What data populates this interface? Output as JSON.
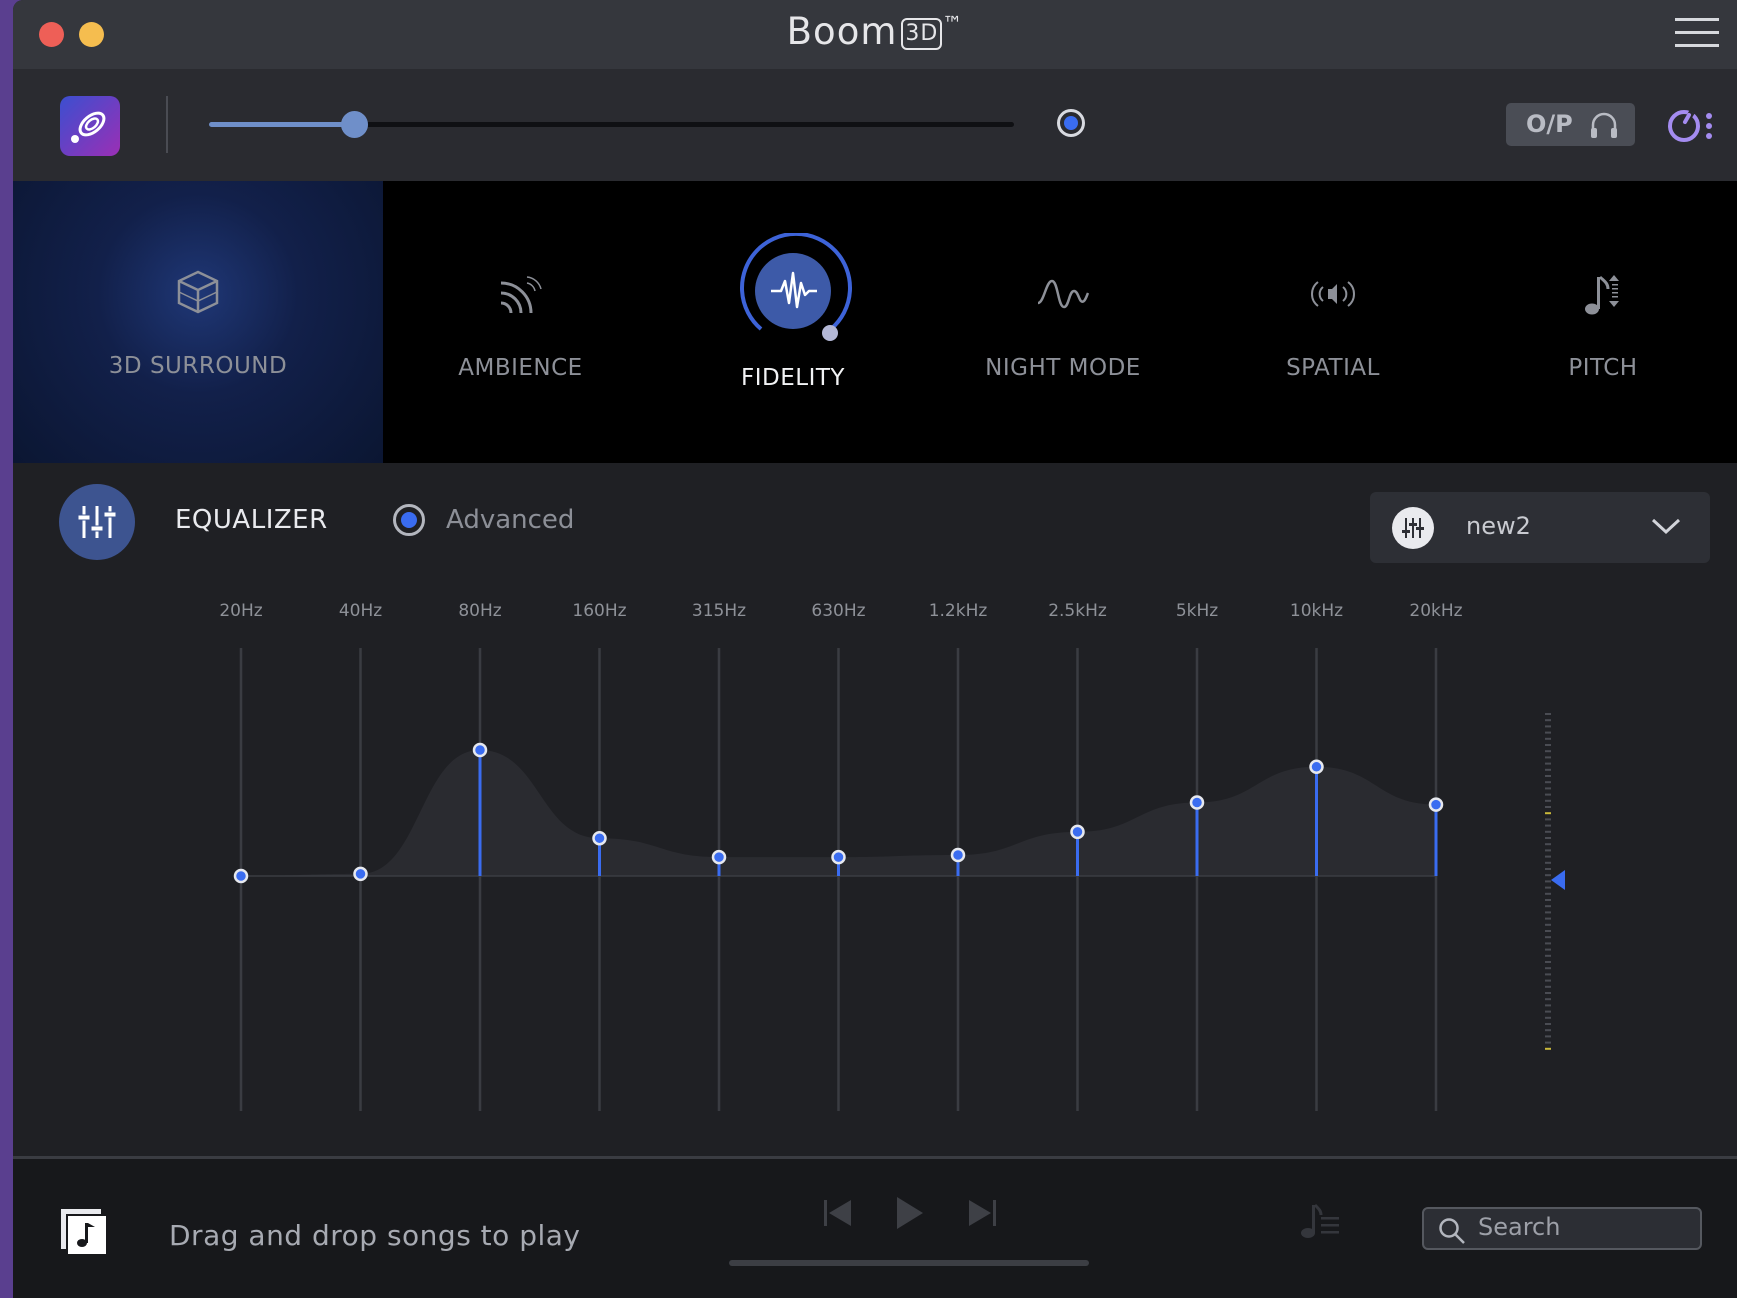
{
  "window": {
    "title_prefix": "Boom",
    "title_badge": "3D",
    "title_tm": "™"
  },
  "volume": {
    "level": 0.18
  },
  "output": {
    "label": "O/P"
  },
  "effects": [
    {
      "id": "surround",
      "label": "3D SURROUND",
      "icon": "cube-icon"
    },
    {
      "id": "ambience",
      "label": "AMBIENCE",
      "icon": "ambience-waves-icon"
    },
    {
      "id": "fidelity",
      "label": "FIDELITY",
      "icon": "pulse-waveform-icon",
      "active": true
    },
    {
      "id": "night",
      "label": "NIGHT MODE",
      "icon": "wave-icon"
    },
    {
      "id": "spatial",
      "label": "SPATIAL",
      "icon": "speaker-signal-icon"
    },
    {
      "id": "pitch",
      "label": "PITCH",
      "icon": "music-note-pitch-icon"
    }
  ],
  "equalizer": {
    "title": "EQUALIZER",
    "advanced_label": "Advanced",
    "preset": "new2",
    "bands": [
      {
        "label": "20Hz",
        "gain": 0.0
      },
      {
        "label": "40Hz",
        "gain": 0.01
      },
      {
        "label": "80Hz",
        "gain": 0.6
      },
      {
        "label": "160Hz",
        "gain": 0.18
      },
      {
        "label": "315Hz",
        "gain": 0.09
      },
      {
        "label": "630Hz",
        "gain": 0.09
      },
      {
        "label": "1.2kHz",
        "gain": 0.1
      },
      {
        "label": "2.5kHz",
        "gain": 0.21
      },
      {
        "label": "5kHz",
        "gain": 0.35
      },
      {
        "label": "10kHz",
        "gain": 0.52
      },
      {
        "label": "20kHz",
        "gain": 0.34
      }
    ],
    "preamp_gain": 0.0
  },
  "player": {
    "drop_text": "Drag and drop songs to play",
    "search_placeholder": "Search"
  },
  "colors": {
    "accent": "#3a6cf0",
    "eq_fill": "#2a2b30"
  }
}
